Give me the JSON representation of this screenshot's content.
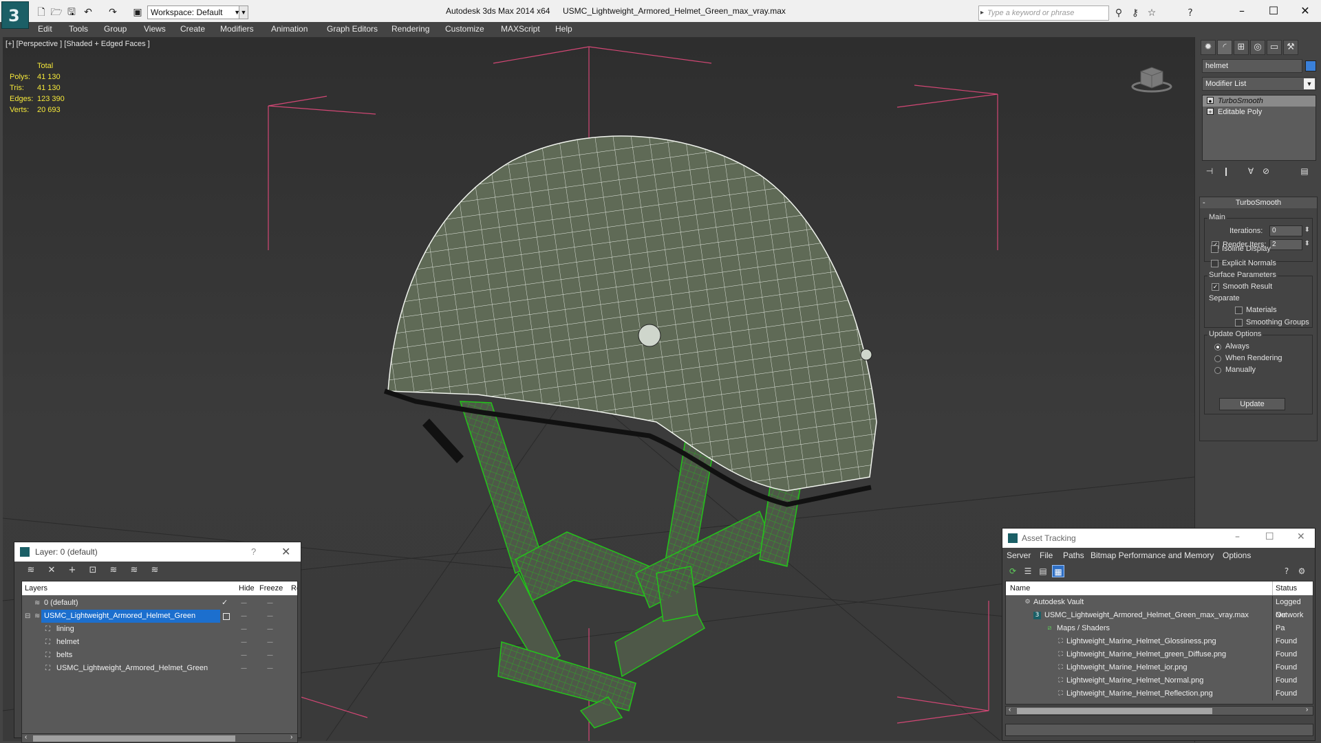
{
  "titlebar": {
    "app_title": "Autodesk 3ds Max  2014 x64",
    "file_name": "USMC_Lightweight_Armored_Helmet_Green_max_vray.max",
    "workspace": "Workspace: Default",
    "search_placeholder": "Type a keyword or phrase",
    "app_icon": "3ds-max-logo-icon",
    "quick_access_icons": [
      "new-file-icon",
      "open-file-icon",
      "save-icon",
      "undo-icon",
      "redo-icon",
      "project-folder-icon"
    ],
    "toolbar_icons": [
      "binoculars-icon",
      "key-icon",
      "star-icon",
      "help-icon"
    ],
    "window_buttons": [
      "minimize-icon",
      "maximize-icon",
      "close-icon"
    ]
  },
  "menubar": {
    "items": [
      "Edit",
      "Tools",
      "Group",
      "Views",
      "Create",
      "Modifiers",
      "Animation",
      "Graph Editors",
      "Rendering",
      "Customize",
      "MAXScript",
      "Help"
    ]
  },
  "viewport": {
    "label": "[+] [Perspective ] [Shaded + Edged Faces ]",
    "stats": {
      "header": "Total",
      "rows": [
        {
          "label": "Polys:",
          "value": "41 130"
        },
        {
          "label": "Tris:",
          "value": "41 130"
        },
        {
          "label": "Edges:",
          "value": "123 390"
        },
        {
          "label": "Verts:",
          "value": "20 693"
        }
      ]
    },
    "helmet_color": "#5f6a56",
    "wire_color": "#23c41a",
    "bbox_color": "#e04a7a"
  },
  "command_panel": {
    "tabs": [
      "create-icon",
      "modify-icon",
      "hierarchy-icon",
      "motion-icon",
      "display-icon",
      "utilities-icon"
    ],
    "object_name": "helmet",
    "object_color": "#3a80d9",
    "modifier_list": "Modifier List",
    "stack": [
      "TurboSmooth",
      "Editable Poly"
    ],
    "stack_tools": [
      "pin-stack-icon",
      "show-end-result-icon",
      "make-unique-icon",
      "remove-modifier-icon",
      "configure-sets-icon"
    ],
    "turbosmooth": {
      "title": "TurboSmooth",
      "main_label": "Main",
      "iterations_label": "Iterations:",
      "iterations_value": "0",
      "render_iters_label": "Render Iters:",
      "render_iters_value": "2",
      "isoline_label": "Isoline Display",
      "explicit_normals_label": "Explicit Normals",
      "surface_params_label": "Surface Parameters",
      "smooth_result_label": "Smooth Result",
      "separate_label": "Separate",
      "materials_label": "Materials",
      "smoothing_groups_label": "Smoothing Groups",
      "update_options_label": "Update Options",
      "always_label": "Always",
      "when_rendering_label": "When Rendering",
      "manually_label": "Manually",
      "update_button": "Update"
    }
  },
  "layer_window": {
    "title": "Layer: 0 (default)",
    "help_symbol": "?",
    "toolbar_icons": [
      "create-layer-icon",
      "delete-layer-icon",
      "add-to-layer-icon",
      "select-in-layer-icon",
      "highlight-layer-icon",
      "hide-all-icon",
      "freeze-all-icon"
    ],
    "columns": {
      "layers": "Layers",
      "hide": "Hide",
      "freeze": "Freeze",
      "render": "Re"
    },
    "dash": "----",
    "check": "✓",
    "rows": [
      {
        "name": "0 (default)"
      },
      {
        "name": "USMC_Lightweight_Armored_Helmet_Green"
      },
      {
        "name": "lining"
      },
      {
        "name": "helmet"
      },
      {
        "name": "belts"
      },
      {
        "name": "USMC_Lightweight_Armored_Helmet_Green"
      }
    ]
  },
  "asset_window": {
    "title": "Asset Tracking",
    "menu": [
      "Server",
      "File",
      "Paths",
      "Bitmap Performance and Memory",
      "Options"
    ],
    "toolbar_icons": [
      "refresh-icon",
      "list-view-icon",
      "table-view-icon",
      "grid-view-icon"
    ],
    "columns": {
      "name": "Name",
      "status": "Status"
    },
    "rows": [
      {
        "name": "Autodesk Vault",
        "status": "Logged Ou"
      },
      {
        "name": "USMC_Lightweight_Armored_Helmet_Green_max_vray.max",
        "status": "Network Pa"
      },
      {
        "name": "Maps / Shaders",
        "status": ""
      },
      {
        "name": "Lightweight_Marine_Helmet_Glossiness.png",
        "status": "Found"
      },
      {
        "name": "Lightweight_Marine_Helmet_green_Diffuse.png",
        "status": "Found"
      },
      {
        "name": "Lightweight_Marine_Helmet_ior.png",
        "status": "Found"
      },
      {
        "name": "Lightweight_Marine_Helmet_Normal.png",
        "status": "Found"
      },
      {
        "name": "Lightweight_Marine_Helmet_Reflection.png",
        "status": "Found"
      }
    ]
  }
}
